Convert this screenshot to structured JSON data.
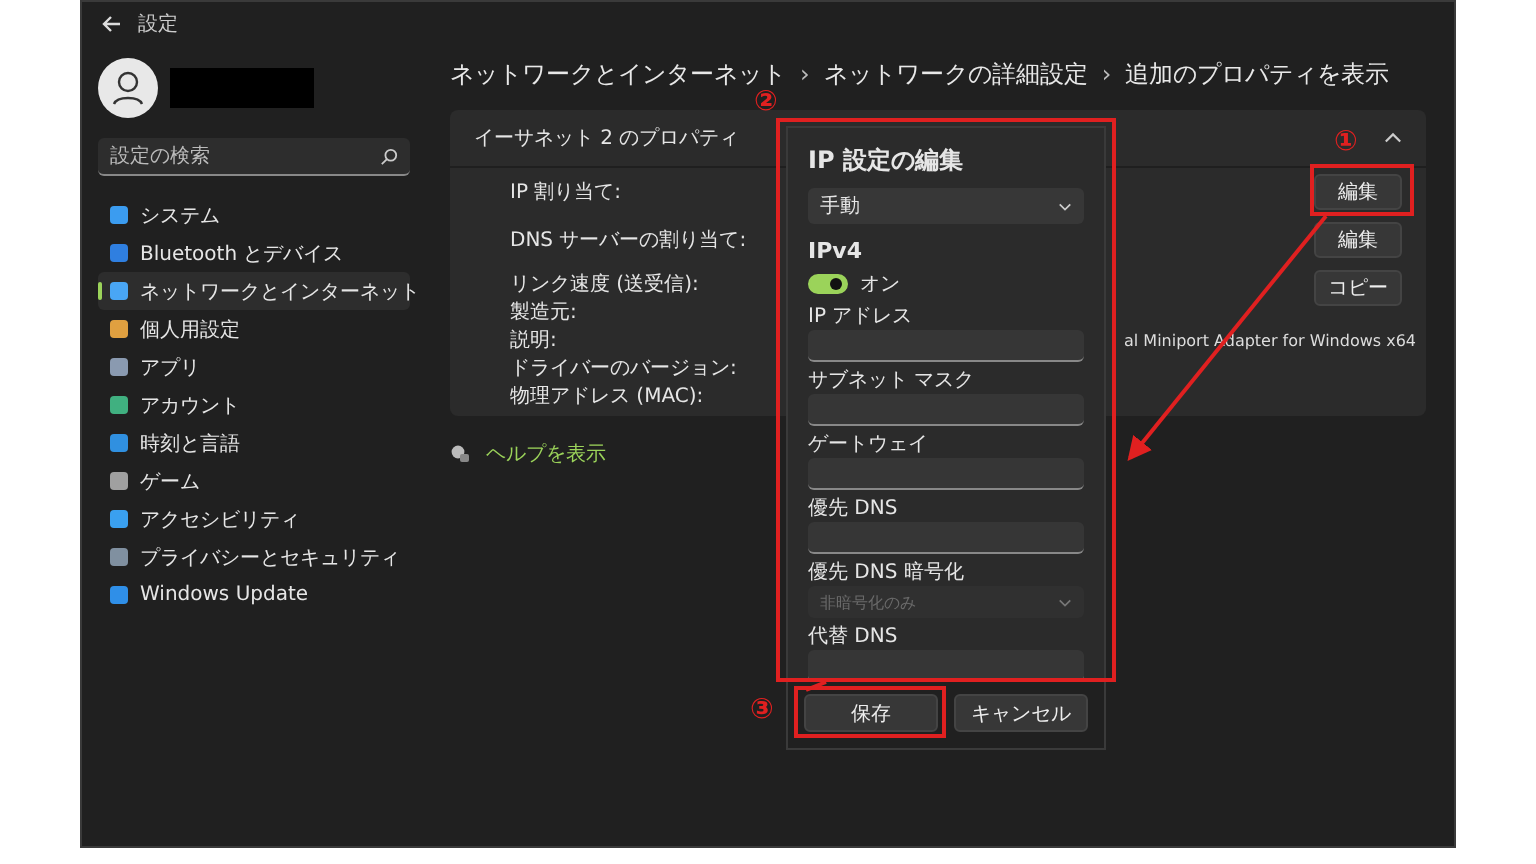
{
  "window": {
    "title": "設定"
  },
  "sidebar": {
    "search_placeholder": "設定の検索",
    "items": [
      {
        "label": "システム",
        "selected": false
      },
      {
        "label": "Bluetooth とデバイス",
        "selected": false
      },
      {
        "label": "ネットワークとインターネット",
        "selected": true
      },
      {
        "label": "個人用設定",
        "selected": false
      },
      {
        "label": "アプリ",
        "selected": false
      },
      {
        "label": "アカウント",
        "selected": false
      },
      {
        "label": "時刻と言語",
        "selected": false
      },
      {
        "label": "ゲーム",
        "selected": false
      },
      {
        "label": "アクセシビリティ",
        "selected": false
      },
      {
        "label": "プライバシーとセキュリティ",
        "selected": false
      },
      {
        "label": "Windows Update",
        "selected": false
      }
    ]
  },
  "breadcrumb": {
    "separator": "›",
    "items": [
      "ネットワークとインターネット",
      "ネットワークの詳細設定",
      "追加のプロパティを表示"
    ]
  },
  "properties": {
    "title": "イーサネット 2 のプロパティ",
    "expanded": true,
    "groups": [
      {
        "button": "編集",
        "rows": [
          {
            "label": "IP 割り当て:"
          }
        ]
      },
      {
        "button": "編集",
        "rows": [
          {
            "label": "DNS サーバーの割り当て:"
          }
        ]
      },
      {
        "button": "コピー",
        "rows": [
          {
            "label": "リンク速度 (送受信):"
          },
          {
            "label": "製造元:"
          },
          {
            "label": "説明:",
            "value": "al Miniport Adapter for Windows x64"
          },
          {
            "label": "ドライバーのバージョン:"
          },
          {
            "label": "物理アドレス (MAC):"
          }
        ]
      }
    ]
  },
  "help_link": "ヘルプを表示",
  "dialog": {
    "title": "IP 設定の編集",
    "mode": "手動",
    "section": "IPv4",
    "toggle": {
      "label": "オン",
      "on": true
    },
    "fields": [
      {
        "kind": "text",
        "label": "IP アドレス"
      },
      {
        "kind": "text",
        "label": "サブネット マスク"
      },
      {
        "kind": "text",
        "label": "ゲートウェイ"
      },
      {
        "kind": "text",
        "label": "優先 DNS"
      },
      {
        "kind": "select",
        "label": "優先 DNS 暗号化",
        "value": "非暗号化のみ",
        "disabled": true
      },
      {
        "kind": "text",
        "label": "代替 DNS"
      }
    ],
    "buttons": [
      "保存",
      "キャンセル"
    ]
  },
  "annotations": [
    {
      "label": "①"
    },
    {
      "label": "②"
    },
    {
      "label": "③"
    }
  ]
}
